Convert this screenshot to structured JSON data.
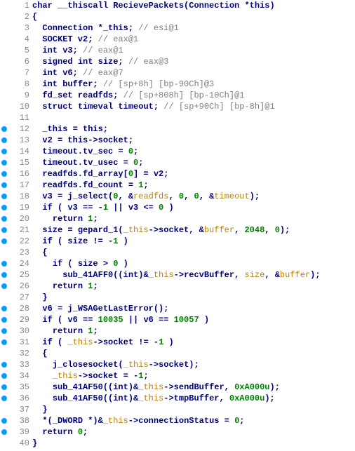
{
  "lines": [
    {
      "n": 1,
      "bp": false,
      "spans": [
        {
          "c": "kw",
          "t": "char"
        },
        {
          "c": "",
          "t": " __thiscall RecievePackets(Connection *"
        },
        {
          "c": "kw",
          "t": "this"
        },
        {
          "c": "",
          "t": ")"
        }
      ]
    },
    {
      "n": 2,
      "bp": false,
      "spans": [
        {
          "c": "",
          "t": "{"
        }
      ]
    },
    {
      "n": 3,
      "bp": false,
      "spans": [
        {
          "c": "",
          "t": "  Connection *_this; "
        },
        {
          "c": "cmt",
          "t": "// esi@1"
        }
      ]
    },
    {
      "n": 4,
      "bp": false,
      "spans": [
        {
          "c": "",
          "t": "  SOCKET v2; "
        },
        {
          "c": "cmt",
          "t": "// eax@1"
        }
      ]
    },
    {
      "n": 5,
      "bp": false,
      "spans": [
        {
          "c": "",
          "t": "  "
        },
        {
          "c": "kw",
          "t": "int"
        },
        {
          "c": "",
          "t": " v3; "
        },
        {
          "c": "cmt",
          "t": "// eax@1"
        }
      ]
    },
    {
      "n": 6,
      "bp": false,
      "spans": [
        {
          "c": "",
          "t": "  "
        },
        {
          "c": "kw",
          "t": "signed"
        },
        {
          "c": "",
          "t": " "
        },
        {
          "c": "kw",
          "t": "int"
        },
        {
          "c": "",
          "t": " size; "
        },
        {
          "c": "cmt",
          "t": "// eax@3"
        }
      ]
    },
    {
      "n": 7,
      "bp": false,
      "spans": [
        {
          "c": "",
          "t": "  "
        },
        {
          "c": "kw",
          "t": "int"
        },
        {
          "c": "",
          "t": " v6; "
        },
        {
          "c": "cmt",
          "t": "// eax@7"
        }
      ]
    },
    {
      "n": 8,
      "bp": false,
      "spans": [
        {
          "c": "",
          "t": "  "
        },
        {
          "c": "kw",
          "t": "int"
        },
        {
          "c": "",
          "t": " buffer; "
        },
        {
          "c": "cmt",
          "t": "// [sp+8h] [bp-90Ch]@3"
        }
      ]
    },
    {
      "n": 9,
      "bp": false,
      "spans": [
        {
          "c": "",
          "t": "  fd_set readfds; "
        },
        {
          "c": "cmt",
          "t": "// [sp+808h] [bp-10Ch]@1"
        }
      ]
    },
    {
      "n": 10,
      "bp": false,
      "spans": [
        {
          "c": "",
          "t": "  "
        },
        {
          "c": "kw",
          "t": "struct"
        },
        {
          "c": "",
          "t": " timeval timeout; "
        },
        {
          "c": "cmt",
          "t": "// [sp+90Ch] [bp-8h]@1"
        }
      ]
    },
    {
      "n": 11,
      "bp": false,
      "spans": []
    },
    {
      "n": 12,
      "bp": true,
      "spans": [
        {
          "c": "",
          "t": "  _this = "
        },
        {
          "c": "kw",
          "t": "this"
        },
        {
          "c": "",
          "t": ";"
        }
      ]
    },
    {
      "n": 13,
      "bp": true,
      "spans": [
        {
          "c": "",
          "t": "  v2 = "
        },
        {
          "c": "kw",
          "t": "this"
        },
        {
          "c": "",
          "t": "->socket;"
        }
      ]
    },
    {
      "n": 14,
      "bp": true,
      "spans": [
        {
          "c": "",
          "t": "  timeout.tv_sec = "
        },
        {
          "c": "num",
          "t": "0"
        },
        {
          "c": "",
          "t": ";"
        }
      ]
    },
    {
      "n": 15,
      "bp": true,
      "spans": [
        {
          "c": "",
          "t": "  timeout.tv_usec = "
        },
        {
          "c": "num",
          "t": "0"
        },
        {
          "c": "",
          "t": ";"
        }
      ]
    },
    {
      "n": 16,
      "bp": true,
      "spans": [
        {
          "c": "",
          "t": "  readfds.fd_array["
        },
        {
          "c": "num",
          "t": "0"
        },
        {
          "c": "",
          "t": "] = v2;"
        }
      ]
    },
    {
      "n": 17,
      "bp": true,
      "spans": [
        {
          "c": "",
          "t": "  readfds.fd_count = "
        },
        {
          "c": "num",
          "t": "1"
        },
        {
          "c": "",
          "t": ";"
        }
      ]
    },
    {
      "n": 18,
      "bp": true,
      "spans": [
        {
          "c": "",
          "t": "  v3 = "
        },
        {
          "c": "fn",
          "t": "j_select"
        },
        {
          "c": "",
          "t": "("
        },
        {
          "c": "num",
          "t": "0"
        },
        {
          "c": "",
          "t": ", &"
        },
        {
          "c": "hl",
          "t": "readfds"
        },
        {
          "c": "",
          "t": ", "
        },
        {
          "c": "num",
          "t": "0"
        },
        {
          "c": "",
          "t": ", "
        },
        {
          "c": "num",
          "t": "0"
        },
        {
          "c": "",
          "t": ", &"
        },
        {
          "c": "hl",
          "t": "timeout"
        },
        {
          "c": "",
          "t": ");"
        }
      ]
    },
    {
      "n": 19,
      "bp": true,
      "spans": [
        {
          "c": "",
          "t": "  "
        },
        {
          "c": "kw",
          "t": "if"
        },
        {
          "c": "",
          "t": " ( v3 == -"
        },
        {
          "c": "num",
          "t": "1"
        },
        {
          "c": "",
          "t": " || v3 <= "
        },
        {
          "c": "num",
          "t": "0"
        },
        {
          "c": "",
          "t": " )"
        }
      ]
    },
    {
      "n": 20,
      "bp": true,
      "spans": [
        {
          "c": "",
          "t": "    "
        },
        {
          "c": "kw",
          "t": "return"
        },
        {
          "c": "",
          "t": " "
        },
        {
          "c": "num",
          "t": "1"
        },
        {
          "c": "",
          "t": ";"
        }
      ]
    },
    {
      "n": 21,
      "bp": true,
      "spans": [
        {
          "c": "",
          "t": "  size = "
        },
        {
          "c": "fn",
          "t": "gepard_1"
        },
        {
          "c": "",
          "t": "("
        },
        {
          "c": "hl",
          "t": "_this"
        },
        {
          "c": "",
          "t": "->socket, &"
        },
        {
          "c": "hl",
          "t": "buffer"
        },
        {
          "c": "",
          "t": ", "
        },
        {
          "c": "num",
          "t": "2048"
        },
        {
          "c": "",
          "t": ", "
        },
        {
          "c": "num",
          "t": "0"
        },
        {
          "c": "",
          "t": ");"
        }
      ]
    },
    {
      "n": 22,
      "bp": true,
      "spans": [
        {
          "c": "",
          "t": "  "
        },
        {
          "c": "kw",
          "t": "if"
        },
        {
          "c": "",
          "t": " ( size != -"
        },
        {
          "c": "num",
          "t": "1"
        },
        {
          "c": "",
          "t": " )"
        }
      ]
    },
    {
      "n": 23,
      "bp": false,
      "spans": [
        {
          "c": "",
          "t": "  {"
        }
      ]
    },
    {
      "n": 24,
      "bp": true,
      "spans": [
        {
          "c": "",
          "t": "    "
        },
        {
          "c": "kw",
          "t": "if"
        },
        {
          "c": "",
          "t": " ( size > "
        },
        {
          "c": "num",
          "t": "0"
        },
        {
          "c": "",
          "t": " )"
        }
      ]
    },
    {
      "n": 25,
      "bp": true,
      "spans": [
        {
          "c": "",
          "t": "      "
        },
        {
          "c": "fn",
          "t": "sub_41AFF0"
        },
        {
          "c": "",
          "t": "(("
        },
        {
          "c": "kw",
          "t": "int"
        },
        {
          "c": "",
          "t": ")&"
        },
        {
          "c": "hl",
          "t": "_this"
        },
        {
          "c": "",
          "t": "->recvBuffer, "
        },
        {
          "c": "hl",
          "t": "size"
        },
        {
          "c": "",
          "t": ", &"
        },
        {
          "c": "hl",
          "t": "buffer"
        },
        {
          "c": "",
          "t": ");"
        }
      ]
    },
    {
      "n": 26,
      "bp": true,
      "spans": [
        {
          "c": "",
          "t": "    "
        },
        {
          "c": "kw",
          "t": "return"
        },
        {
          "c": "",
          "t": " "
        },
        {
          "c": "num",
          "t": "1"
        },
        {
          "c": "",
          "t": ";"
        }
      ]
    },
    {
      "n": 27,
      "bp": false,
      "spans": [
        {
          "c": "",
          "t": "  }"
        }
      ]
    },
    {
      "n": 28,
      "bp": true,
      "spans": [
        {
          "c": "",
          "t": "  v6 = "
        },
        {
          "c": "fn",
          "t": "j_WSAGetLastError"
        },
        {
          "c": "",
          "t": "();"
        }
      ]
    },
    {
      "n": 29,
      "bp": true,
      "spans": [
        {
          "c": "",
          "t": "  "
        },
        {
          "c": "kw",
          "t": "if"
        },
        {
          "c": "",
          "t": " ( v6 == "
        },
        {
          "c": "num",
          "t": "10035"
        },
        {
          "c": "",
          "t": " || v6 == "
        },
        {
          "c": "num",
          "t": "10057"
        },
        {
          "c": "",
          "t": " )"
        }
      ]
    },
    {
      "n": 30,
      "bp": true,
      "spans": [
        {
          "c": "",
          "t": "    "
        },
        {
          "c": "kw",
          "t": "return"
        },
        {
          "c": "",
          "t": " "
        },
        {
          "c": "num",
          "t": "1"
        },
        {
          "c": "",
          "t": ";"
        }
      ]
    },
    {
      "n": 31,
      "bp": true,
      "spans": [
        {
          "c": "",
          "t": "  "
        },
        {
          "c": "kw",
          "t": "if"
        },
        {
          "c": "",
          "t": " ( "
        },
        {
          "c": "hl",
          "t": "_this"
        },
        {
          "c": "",
          "t": "->socket != -"
        },
        {
          "c": "num",
          "t": "1"
        },
        {
          "c": "",
          "t": " )"
        }
      ]
    },
    {
      "n": 32,
      "bp": false,
      "spans": [
        {
          "c": "",
          "t": "  {"
        }
      ]
    },
    {
      "n": 33,
      "bp": true,
      "spans": [
        {
          "c": "",
          "t": "    "
        },
        {
          "c": "fn",
          "t": "j_closesocket"
        },
        {
          "c": "",
          "t": "("
        },
        {
          "c": "hl",
          "t": "_this"
        },
        {
          "c": "",
          "t": "->socket);"
        }
      ]
    },
    {
      "n": 34,
      "bp": true,
      "spans": [
        {
          "c": "",
          "t": "    "
        },
        {
          "c": "hl",
          "t": "_this"
        },
        {
          "c": "",
          "t": "->socket = -"
        },
        {
          "c": "num",
          "t": "1"
        },
        {
          "c": "",
          "t": ";"
        }
      ]
    },
    {
      "n": 35,
      "bp": true,
      "spans": [
        {
          "c": "",
          "t": "    "
        },
        {
          "c": "fn",
          "t": "sub_41AF50"
        },
        {
          "c": "",
          "t": "(("
        },
        {
          "c": "kw",
          "t": "int"
        },
        {
          "c": "",
          "t": ")&"
        },
        {
          "c": "hl",
          "t": "_this"
        },
        {
          "c": "",
          "t": "->sendBuffer, "
        },
        {
          "c": "num",
          "t": "0xA000u"
        },
        {
          "c": "",
          "t": ");"
        }
      ]
    },
    {
      "n": 36,
      "bp": true,
      "spans": [
        {
          "c": "",
          "t": "    "
        },
        {
          "c": "fn",
          "t": "sub_41AF50"
        },
        {
          "c": "",
          "t": "(("
        },
        {
          "c": "kw",
          "t": "int"
        },
        {
          "c": "",
          "t": ")&"
        },
        {
          "c": "hl",
          "t": "_this"
        },
        {
          "c": "",
          "t": "->tmpBuffer, "
        },
        {
          "c": "num",
          "t": "0xA000u"
        },
        {
          "c": "",
          "t": ");"
        }
      ]
    },
    {
      "n": 37,
      "bp": false,
      "spans": [
        {
          "c": "",
          "t": "  }"
        }
      ]
    },
    {
      "n": 38,
      "bp": true,
      "spans": [
        {
          "c": "",
          "t": "  *("
        },
        {
          "c": "kw",
          "t": "_DWORD"
        },
        {
          "c": "",
          "t": " *)&"
        },
        {
          "c": "hl",
          "t": "_this"
        },
        {
          "c": "",
          "t": "->connectionStatus = "
        },
        {
          "c": "num",
          "t": "0"
        },
        {
          "c": "",
          "t": ";"
        }
      ]
    },
    {
      "n": 39,
      "bp": true,
      "spans": [
        {
          "c": "",
          "t": "  "
        },
        {
          "c": "kw",
          "t": "return"
        },
        {
          "c": "",
          "t": " "
        },
        {
          "c": "num",
          "t": "0"
        },
        {
          "c": "",
          "t": ";"
        }
      ]
    },
    {
      "n": 40,
      "bp": false,
      "spans": [
        {
          "c": "",
          "t": "}"
        }
      ]
    }
  ]
}
